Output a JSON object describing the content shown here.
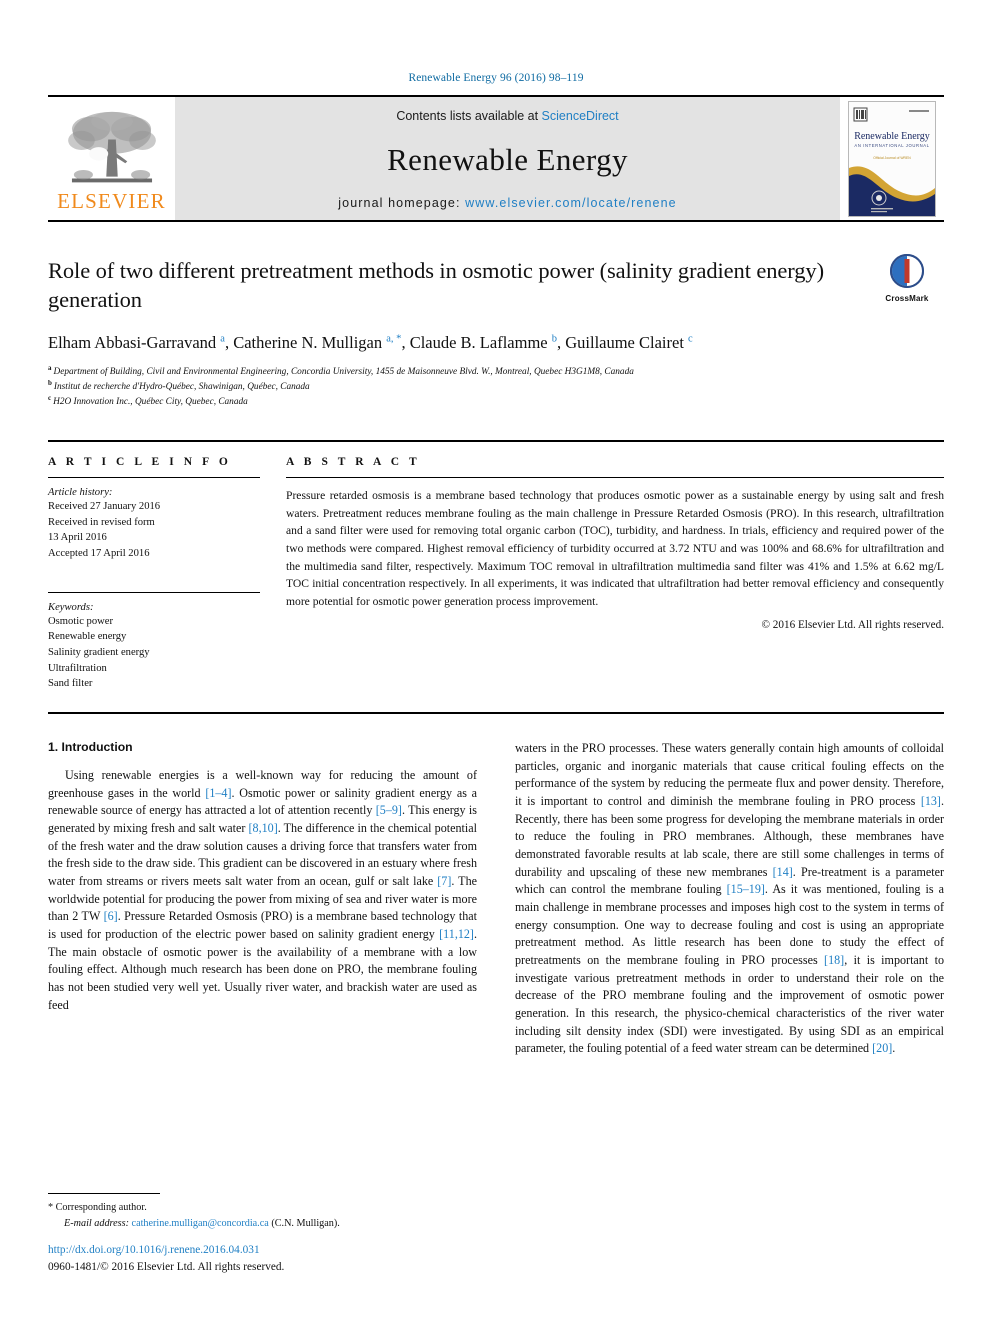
{
  "running_head": "Renewable Energy 96 (2016) 98–119",
  "masthead": {
    "publisher_name": "ELSEVIER",
    "contents_prefix": "Contents lists available at ",
    "contents_link": "ScienceDirect",
    "journal_title": "Renewable Energy",
    "homepage_prefix": "journal homepage: ",
    "homepage_url": "www.elsevier.com/locate/renene",
    "cover_title": "Renewable Energy",
    "cover_subtitle": "AN INTERNATIONAL JOURNAL",
    "cover_tagline": "Official Journal of WREN – World Renewable Energy Network",
    "cover_footer": "Available online at www.sciencedirect.com"
  },
  "article": {
    "title": "Role of two different pretreatment methods in osmotic power (salinity gradient energy) generation",
    "crossmark_label": "CrossMark",
    "authors": [
      {
        "name": "Elham Abbasi-Garravand",
        "marks": "a",
        "sep": ", "
      },
      {
        "name": "Catherine N. Mulligan",
        "marks": "a, *",
        "sep": ", "
      },
      {
        "name": "Claude B. Laflamme",
        "marks": "b",
        "sep": ", "
      },
      {
        "name": "Guillaume Clairet",
        "marks": "c",
        "sep": ""
      }
    ],
    "affiliations": [
      {
        "mark": "a",
        "text": "Department of Building, Civil and Environmental Engineering, Concordia University, 1455 de Maisonneuve Blvd. W., Montreal, Quebec H3G1M8, Canada"
      },
      {
        "mark": "b",
        "text": "Institut de recherche d'Hydro-Québec, Shawinigan, Québec, Canada"
      },
      {
        "mark": "c",
        "text": "H2O Innovation Inc., Québec City, Quebec, Canada"
      }
    ]
  },
  "article_info": {
    "heading": "A R T I C L E   I N F O",
    "history_label": "Article history:",
    "history_lines": [
      "Received 27 January 2016",
      "Received in revised form",
      "13 April 2016",
      "Accepted 17 April 2016"
    ],
    "keywords_label": "Keywords:",
    "keywords": [
      "Osmotic power",
      "Renewable energy",
      "Salinity gradient energy",
      "Ultrafiltration",
      "Sand filter"
    ]
  },
  "abstract": {
    "heading": "A B S T R A C T",
    "text": "Pressure retarded osmosis is a membrane based technology that produces osmotic power as a sustainable energy by using salt and fresh waters. Pretreatment reduces membrane fouling as the main challenge in Pressure Retarded Osmosis (PRO). In this research, ultrafiltration and a sand filter were used for removing total organic carbon (TOC), turbidity, and hardness. In trials, efficiency and required power of the two methods were compared. Highest removal efficiency of turbidity occurred at 3.72 NTU and was 100% and 68.6% for ultrafiltration and the multimedia sand filter, respectively. Maximum TOC removal in ultrafiltration multimedia sand filter was 41% and 1.5% at 6.62 mg/L TOC initial concentration respectively. In all experiments, it was indicated that ultrafiltration had better removal efficiency and consequently more potential for osmotic power generation process improvement.",
    "copyright": "© 2016 Elsevier Ltd. All rights reserved."
  },
  "body": {
    "section_number_title": "1. Introduction",
    "left_paragraph_parts": [
      {
        "t": "Using renewable energies is a well-known way for reducing the amount of greenhouse gases in the world ",
        "ref": false
      },
      {
        "t": "[1–4]",
        "ref": true
      },
      {
        "t": ". Osmotic power or salinity gradient energy as a renewable source of energy has attracted a lot of attention recently ",
        "ref": false
      },
      {
        "t": "[5–9]",
        "ref": true
      },
      {
        "t": ". This energy is generated by mixing fresh and salt water ",
        "ref": false
      },
      {
        "t": "[8,10]",
        "ref": true
      },
      {
        "t": ". The difference in the chemical potential of the fresh water and the draw solution causes a driving force that transfers water from the fresh side to the draw side. This gradient can be discovered in an estuary where fresh water from streams or rivers meets salt water from an ocean, gulf or salt lake ",
        "ref": false
      },
      {
        "t": "[7]",
        "ref": true
      },
      {
        "t": ". The worldwide potential for producing the power from mixing of sea and river water is more than 2 TW ",
        "ref": false
      },
      {
        "t": "[6]",
        "ref": true
      },
      {
        "t": ". Pressure Retarded Osmosis (PRO) is a membrane based technology that is used for production of the electric power based on salinity gradient energy ",
        "ref": false
      },
      {
        "t": "[11,12]",
        "ref": true
      },
      {
        "t": ". The main obstacle of osmotic power is the availability of a membrane with a low fouling effect. Although much research has been done on PRO, the membrane fouling has not been studied very well yet. Usually river water, and brackish water are used as feed",
        "ref": false
      }
    ],
    "right_paragraph_parts": [
      {
        "t": "waters in the PRO processes. These waters generally contain high amounts of colloidal particles, organic and inorganic materials that cause critical fouling effects on the performance of the system by reducing the permeate flux and power density. Therefore, it is important to control and diminish the membrane fouling in PRO process ",
        "ref": false
      },
      {
        "t": "[13]",
        "ref": true
      },
      {
        "t": ". Recently, there has been some progress for developing the membrane materials in order to reduce the fouling in PRO membranes. Although, these membranes have demonstrated favorable results at lab scale, there are still some challenges in terms of durability and upscaling of these new membranes ",
        "ref": false
      },
      {
        "t": "[14]",
        "ref": true
      },
      {
        "t": ". Pre-treatment is a parameter which can control the membrane fouling ",
        "ref": false
      },
      {
        "t": "[15–19]",
        "ref": true
      },
      {
        "t": ". As it was mentioned, fouling is a main challenge in membrane processes and imposes high cost to the system in terms of energy consumption. One way to decrease fouling and cost is using an appropriate pretreatment method. As little research has been done to study the effect of pretreatments on the membrane fouling in PRO processes ",
        "ref": false
      },
      {
        "t": "[18]",
        "ref": true
      },
      {
        "t": ", it is important to investigate various pretreatment methods in order to understand their role on the decrease of the PRO membrane fouling and the improvement of osmotic power generation. In this research, the physico-chemical characteristics of the river water including silt density index (SDI) were investigated. By using SDI as an empirical parameter, the fouling potential of a feed water stream can be determined ",
        "ref": false
      },
      {
        "t": "[20]",
        "ref": true
      },
      {
        "t": ".",
        "ref": false
      }
    ]
  },
  "footnote": {
    "star": "*",
    "corresponding": "Corresponding author.",
    "email_label": "E-mail address:",
    "email": "catherine.mulligan@concordia.ca",
    "email_suffix": "(C.N. Mulligan)."
  },
  "footer": {
    "doi": "http://dx.doi.org/10.1016/j.renene.2016.04.031",
    "issn": "0960-1481/© 2016 Elsevier Ltd. All rights reserved."
  },
  "colors": {
    "link": "#1f7fc4",
    "elsevier_orange": "#f08a1c",
    "masthead_bg": "#e3e3e3",
    "cover_navy": "#1b2a63"
  }
}
